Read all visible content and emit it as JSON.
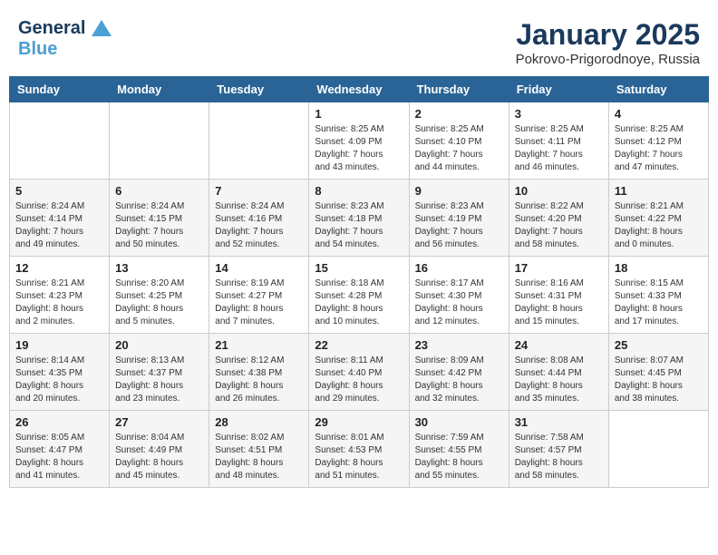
{
  "header": {
    "logo_line1": "General",
    "logo_line2": "Blue",
    "month_title": "January 2025",
    "location": "Pokrovo-Prigorodnoye, Russia"
  },
  "days_of_week": [
    "Sunday",
    "Monday",
    "Tuesday",
    "Wednesday",
    "Thursday",
    "Friday",
    "Saturday"
  ],
  "weeks": [
    [
      {
        "day": "",
        "info": ""
      },
      {
        "day": "",
        "info": ""
      },
      {
        "day": "",
        "info": ""
      },
      {
        "day": "1",
        "info": "Sunrise: 8:25 AM\nSunset: 4:09 PM\nDaylight: 7 hours\nand 43 minutes."
      },
      {
        "day": "2",
        "info": "Sunrise: 8:25 AM\nSunset: 4:10 PM\nDaylight: 7 hours\nand 44 minutes."
      },
      {
        "day": "3",
        "info": "Sunrise: 8:25 AM\nSunset: 4:11 PM\nDaylight: 7 hours\nand 46 minutes."
      },
      {
        "day": "4",
        "info": "Sunrise: 8:25 AM\nSunset: 4:12 PM\nDaylight: 7 hours\nand 47 minutes."
      }
    ],
    [
      {
        "day": "5",
        "info": "Sunrise: 8:24 AM\nSunset: 4:14 PM\nDaylight: 7 hours\nand 49 minutes."
      },
      {
        "day": "6",
        "info": "Sunrise: 8:24 AM\nSunset: 4:15 PM\nDaylight: 7 hours\nand 50 minutes."
      },
      {
        "day": "7",
        "info": "Sunrise: 8:24 AM\nSunset: 4:16 PM\nDaylight: 7 hours\nand 52 minutes."
      },
      {
        "day": "8",
        "info": "Sunrise: 8:23 AM\nSunset: 4:18 PM\nDaylight: 7 hours\nand 54 minutes."
      },
      {
        "day": "9",
        "info": "Sunrise: 8:23 AM\nSunset: 4:19 PM\nDaylight: 7 hours\nand 56 minutes."
      },
      {
        "day": "10",
        "info": "Sunrise: 8:22 AM\nSunset: 4:20 PM\nDaylight: 7 hours\nand 58 minutes."
      },
      {
        "day": "11",
        "info": "Sunrise: 8:21 AM\nSunset: 4:22 PM\nDaylight: 8 hours\nand 0 minutes."
      }
    ],
    [
      {
        "day": "12",
        "info": "Sunrise: 8:21 AM\nSunset: 4:23 PM\nDaylight: 8 hours\nand 2 minutes."
      },
      {
        "day": "13",
        "info": "Sunrise: 8:20 AM\nSunset: 4:25 PM\nDaylight: 8 hours\nand 5 minutes."
      },
      {
        "day": "14",
        "info": "Sunrise: 8:19 AM\nSunset: 4:27 PM\nDaylight: 8 hours\nand 7 minutes."
      },
      {
        "day": "15",
        "info": "Sunrise: 8:18 AM\nSunset: 4:28 PM\nDaylight: 8 hours\nand 10 minutes."
      },
      {
        "day": "16",
        "info": "Sunrise: 8:17 AM\nSunset: 4:30 PM\nDaylight: 8 hours\nand 12 minutes."
      },
      {
        "day": "17",
        "info": "Sunrise: 8:16 AM\nSunset: 4:31 PM\nDaylight: 8 hours\nand 15 minutes."
      },
      {
        "day": "18",
        "info": "Sunrise: 8:15 AM\nSunset: 4:33 PM\nDaylight: 8 hours\nand 17 minutes."
      }
    ],
    [
      {
        "day": "19",
        "info": "Sunrise: 8:14 AM\nSunset: 4:35 PM\nDaylight: 8 hours\nand 20 minutes."
      },
      {
        "day": "20",
        "info": "Sunrise: 8:13 AM\nSunset: 4:37 PM\nDaylight: 8 hours\nand 23 minutes."
      },
      {
        "day": "21",
        "info": "Sunrise: 8:12 AM\nSunset: 4:38 PM\nDaylight: 8 hours\nand 26 minutes."
      },
      {
        "day": "22",
        "info": "Sunrise: 8:11 AM\nSunset: 4:40 PM\nDaylight: 8 hours\nand 29 minutes."
      },
      {
        "day": "23",
        "info": "Sunrise: 8:09 AM\nSunset: 4:42 PM\nDaylight: 8 hours\nand 32 minutes."
      },
      {
        "day": "24",
        "info": "Sunrise: 8:08 AM\nSunset: 4:44 PM\nDaylight: 8 hours\nand 35 minutes."
      },
      {
        "day": "25",
        "info": "Sunrise: 8:07 AM\nSunset: 4:45 PM\nDaylight: 8 hours\nand 38 minutes."
      }
    ],
    [
      {
        "day": "26",
        "info": "Sunrise: 8:05 AM\nSunset: 4:47 PM\nDaylight: 8 hours\nand 41 minutes."
      },
      {
        "day": "27",
        "info": "Sunrise: 8:04 AM\nSunset: 4:49 PM\nDaylight: 8 hours\nand 45 minutes."
      },
      {
        "day": "28",
        "info": "Sunrise: 8:02 AM\nSunset: 4:51 PM\nDaylight: 8 hours\nand 48 minutes."
      },
      {
        "day": "29",
        "info": "Sunrise: 8:01 AM\nSunset: 4:53 PM\nDaylight: 8 hours\nand 51 minutes."
      },
      {
        "day": "30",
        "info": "Sunrise: 7:59 AM\nSunset: 4:55 PM\nDaylight: 8 hours\nand 55 minutes."
      },
      {
        "day": "31",
        "info": "Sunrise: 7:58 AM\nSunset: 4:57 PM\nDaylight: 8 hours\nand 58 minutes."
      },
      {
        "day": "",
        "info": ""
      }
    ]
  ]
}
